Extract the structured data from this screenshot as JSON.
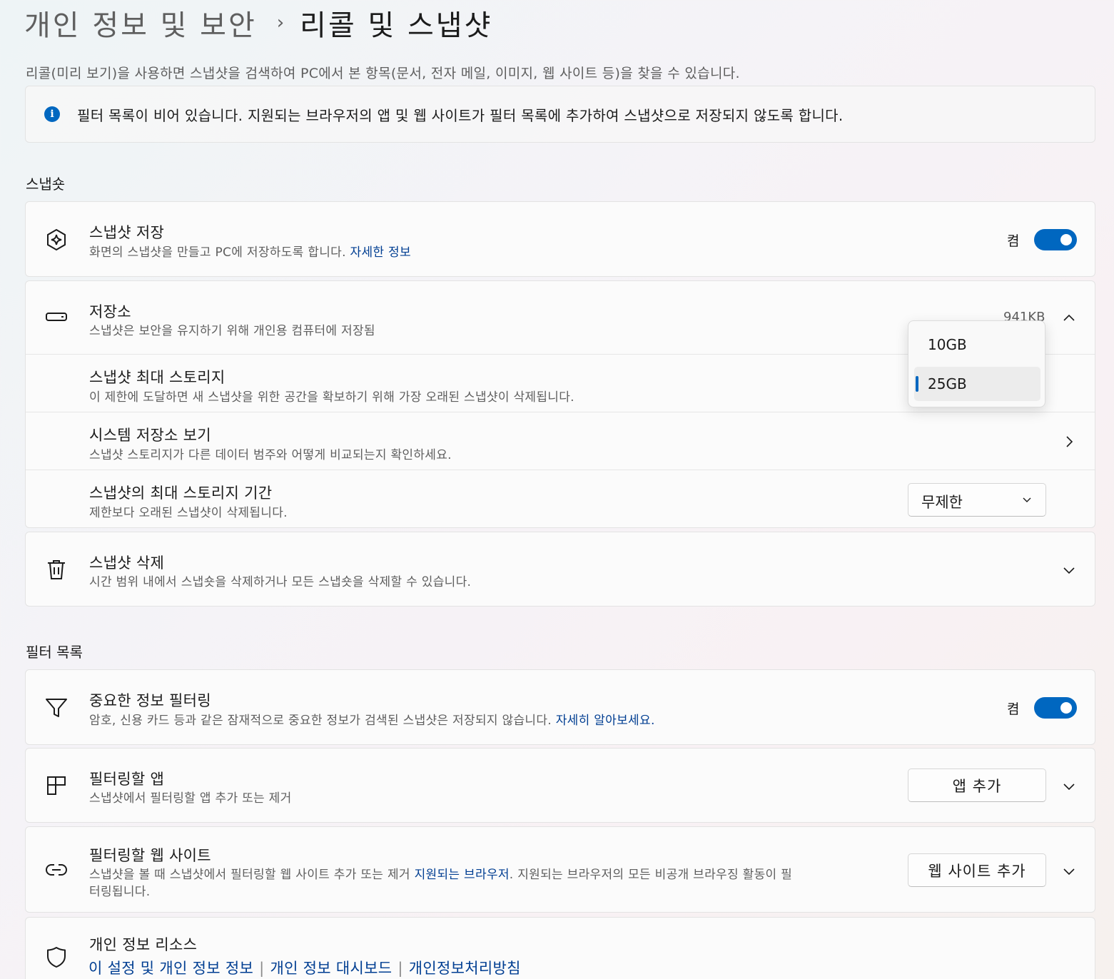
{
  "breadcrumb": {
    "parent": "개인 정보 및 보안",
    "separator": "›",
    "current": "리콜 및 스냅샷"
  },
  "description": "리콜(미리 보기)을 사용하면 스냅샷을 검색하여 PC에서 본 항목(문서, 전자 메일, 이미지, 웹 사이트 등)을 찾을 수 있습니다.",
  "info_bar": {
    "icon": "info-icon",
    "text": "필터 목록이 비어 있습니다. 지원되는 브라우저의 앱 및 웹 사이트가 필터 목록에 추가하여 스냅샷으로 저장되지 않도록 합니다."
  },
  "snapshots_section": {
    "title": "스냅숏",
    "save": {
      "icon": "snapshot-sparkle-icon",
      "title": "스냅샷 저장",
      "subtitle": "화면의 스냅샷을 만들고 PC에 저장하도록 합니다.",
      "link": "자세한 정보",
      "toggle_label": "켬",
      "toggle_on": true
    },
    "storage": {
      "icon": "storage-drive-icon",
      "title": "저장소",
      "subtitle": "스냅샷은 보안을 유지하기 위해 개인용 컴퓨터에 저장됨",
      "value": "941KB",
      "expanded": true,
      "max_storage": {
        "title": "스냅샷 최대 스토리지",
        "subtitle": "이 제한에 도달하면 새 스냅샷을 위한 공간을 확보하기 위해 가장 오래된 스냅샷이 삭제됩니다.",
        "options": [
          "10GB",
          "25GB"
        ],
        "selected": "25GB"
      },
      "system_storage": {
        "title": "시스템 저장소 보기",
        "subtitle": "스냅샷 스토리지가 다른 데이터 범주와 어떻게 비교되는지 확인하세요."
      },
      "max_duration": {
        "title": "스냅샷의 최대 스토리지 기간",
        "subtitle": "제한보다 오래된 스냅샷이 삭제됩니다.",
        "value": "무제한"
      }
    },
    "delete": {
      "icon": "trash-icon",
      "title": "스냅샷 삭제",
      "subtitle": "시간 범위 내에서 스냅숏을 삭제하거나 모든 스냅숏을 삭제할 수 있습니다."
    }
  },
  "filter_section": {
    "title": "필터 목록",
    "sensitive": {
      "icon": "filter-icon",
      "title": "중요한 정보 필터링",
      "subtitle": "암호, 신용 카드 등과 같은 잠재적으로 중요한 정보가 검색된 스냅샷은 저장되지 않습니다.",
      "link": "자세히 알아보세요.",
      "toggle_label": "켬",
      "toggle_on": true
    },
    "apps": {
      "icon": "apps-icon",
      "title": "필터링할 앱",
      "subtitle": "스냅샷에서 필터링할 앱 추가 또는 제거",
      "button": "앱 추가"
    },
    "websites": {
      "icon": "link-icon",
      "title": "필터링할 웹 사이트",
      "subtitle_a": "스냅샷을 볼 때 스냅샷에서 필터링할 웹 사이트 추가 또는 제거",
      "subtitle_link": "지원되는 브라우저",
      "subtitle_b": ". 지원되는 브라우저의 모든 비공개 브라우징 활동이 필",
      "subtitle_c": "터링됩니다.",
      "button": "웹 사이트 추가"
    },
    "privacy": {
      "icon": "shield-icon",
      "title": "개인 정보 리소스",
      "links": [
        "이 설정 및 개인 정보 정보",
        "개인 정보 대시보드",
        "개인정보처리방침"
      ]
    }
  }
}
